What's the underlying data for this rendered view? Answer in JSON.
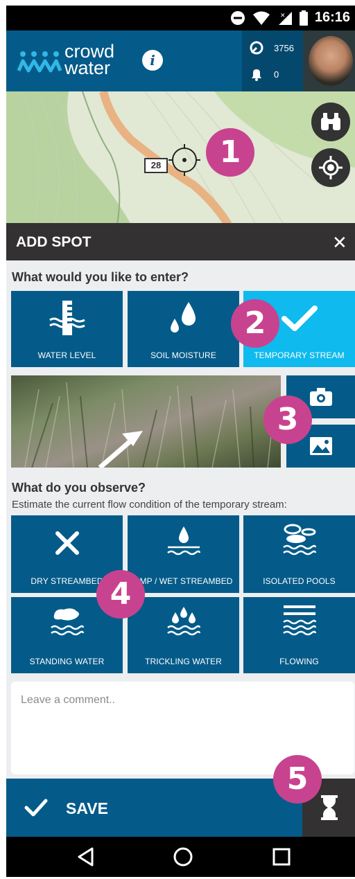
{
  "status_bar": {
    "time": "16:16"
  },
  "header": {
    "logo_line1": "crowd",
    "logo_line2": "water",
    "info_icon": "i",
    "points": "3756",
    "notifications": "0"
  },
  "map": {
    "road_number": "28"
  },
  "badges": [
    "1",
    "2",
    "3",
    "4",
    "5"
  ],
  "add_spot": {
    "title": "ADD SPOT",
    "close": "✕"
  },
  "entry": {
    "question": "What would you like to enter?",
    "options": [
      {
        "label": "WATER LEVEL",
        "icon": "water-level-icon"
      },
      {
        "label": "SOIL MOISTURE",
        "icon": "soil-moisture-icon"
      },
      {
        "label": "TEMPORARY STREAM",
        "icon": "checkmark-icon",
        "selected": true
      }
    ]
  },
  "observe": {
    "question": "What do you observe?",
    "hint": "Estimate the current flow condition of the temporary stream:",
    "options": [
      {
        "label": "DRY STREAMBED",
        "icon": "x-icon"
      },
      {
        "label": "AMP / WET STREAMBED",
        "icon": "drop-waves-icon"
      },
      {
        "label": "ISOLATED POOLS",
        "icon": "pools-icon"
      },
      {
        "label": "STANDING WATER",
        "icon": "standing-water-icon"
      },
      {
        "label": "TRICKLING WATER",
        "icon": "trickling-water-icon"
      },
      {
        "label": "FLOWING",
        "icon": "flowing-icon"
      }
    ]
  },
  "comment": {
    "placeholder": "Leave a comment.."
  },
  "save": {
    "label": "SAVE"
  },
  "colors": {
    "primary": "#045b89",
    "selected": "#0fbaee",
    "dark": "#333131",
    "badge": "#c8438f"
  }
}
